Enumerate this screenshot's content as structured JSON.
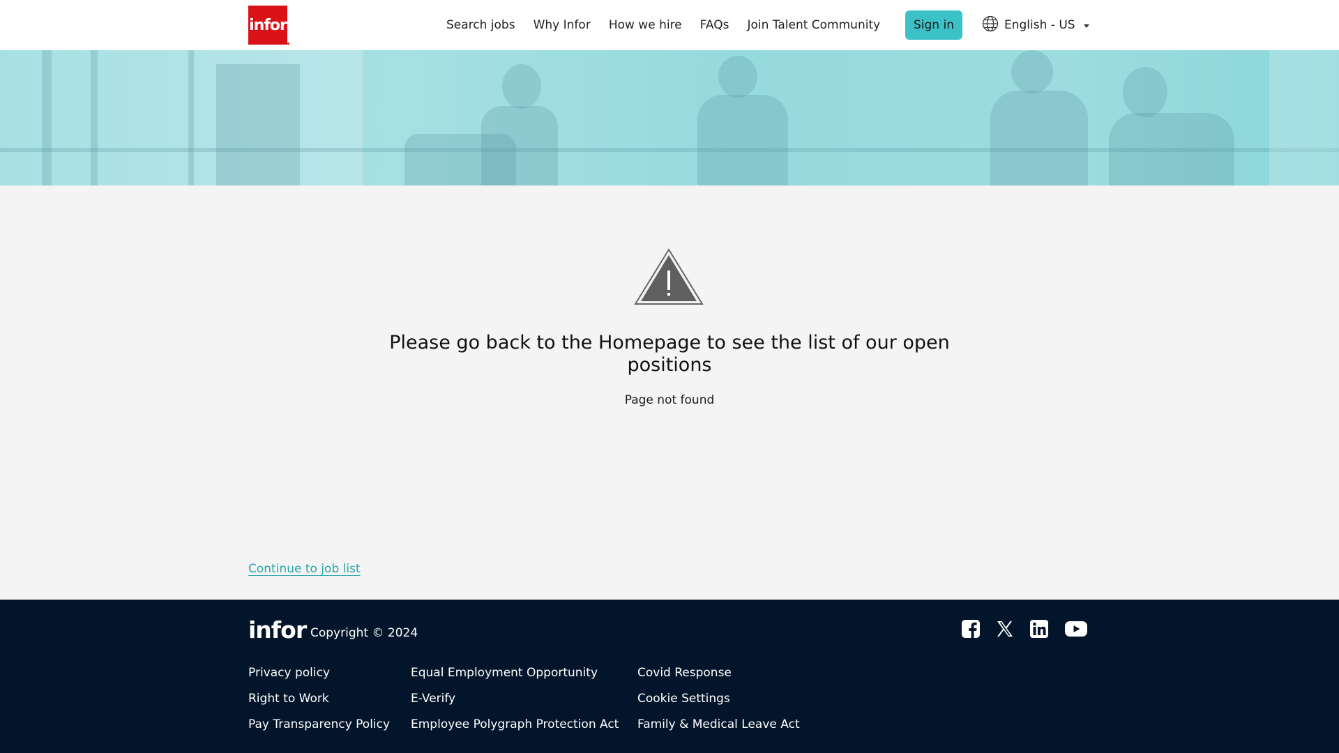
{
  "header": {
    "logo_text": "infor",
    "nav": [
      {
        "label": "Search jobs"
      },
      {
        "label": "Why Infor"
      },
      {
        "label": "How we hire"
      },
      {
        "label": "FAQs"
      },
      {
        "label": "Join Talent Community"
      }
    ],
    "signin_label": "Sign in",
    "language": "English - US",
    "icons": {
      "language": "globe-icon",
      "dropdown": "caret-down-icon"
    }
  },
  "hero": {
    "icon": "office-meeting-photo"
  },
  "main": {
    "icon": "warning-triangle-icon",
    "title": "Please go back to the Homepage to see the list of our open positions",
    "subtitle": "Page not found",
    "continue_link": "Continue to job list"
  },
  "footer": {
    "logo_text": "infor",
    "copyright": "Copyright © 2024",
    "social": [
      "facebook-icon",
      "x-twitter-icon",
      "linkedin-icon",
      "youtube-icon"
    ],
    "columns": [
      [
        "Privacy policy",
        "Right to Work",
        "Pay Transparency Policy"
      ],
      [
        "Equal Employment Opportunity",
        "E-Verify",
        "Employee Polygraph Protection Act"
      ],
      [
        "Covid Response",
        "Cookie Settings",
        "Family & Medical Leave Act"
      ]
    ]
  },
  "colors": {
    "brand_red": "#da1217",
    "accent_teal": "#3cc2c6",
    "link_teal": "#2aa6ab",
    "footer_bg": "#03152a",
    "page_bg": "#f4f4f4",
    "hero_tint": "#95dadd"
  }
}
